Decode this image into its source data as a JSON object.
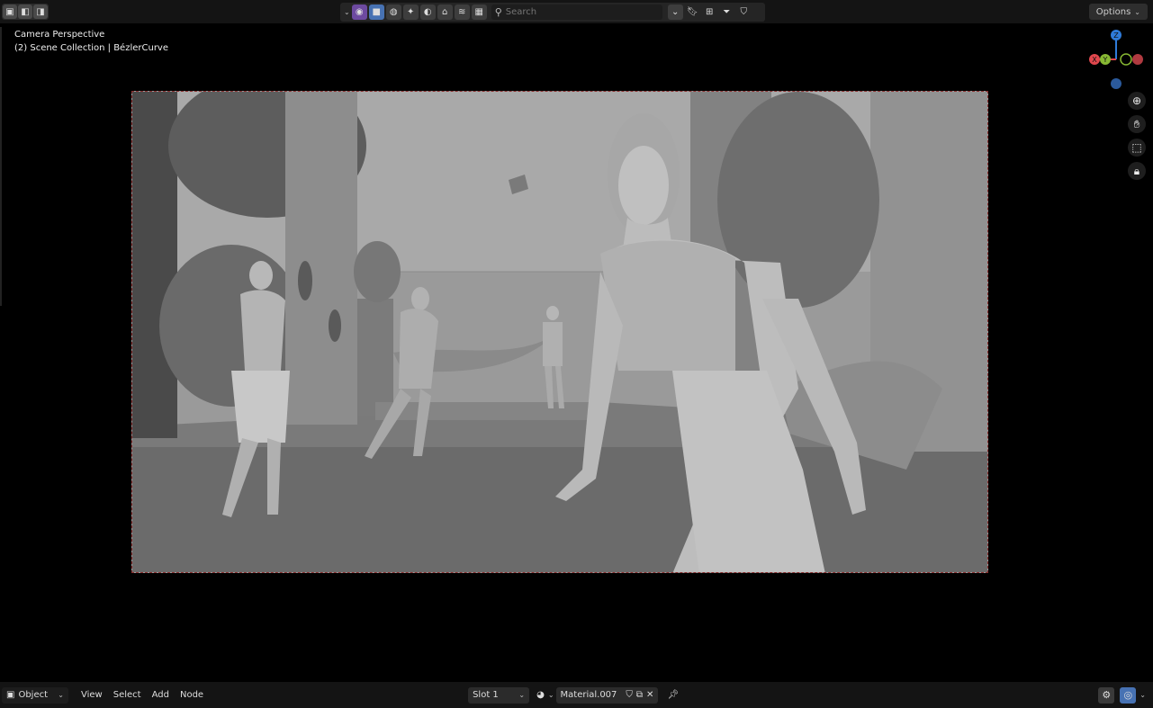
{
  "header": {
    "search_placeholder": "Search",
    "options_label": "Options"
  },
  "viewport": {
    "line1": "Camera Perspective",
    "line2": "(2) Scene Collection | BézlerCurve"
  },
  "gizmo": {
    "z": "Z",
    "y": "Y",
    "x": "X"
  },
  "footer": {
    "mode_label": "Object",
    "menus": [
      "View",
      "Select",
      "Add",
      "Node"
    ],
    "slot_label": "Slot 1",
    "material_name": "Material.007"
  },
  "colors": {
    "accent": "#4772b3",
    "axis_x": "#e0474d",
    "axis_y": "#87b833",
    "axis_z": "#2f7bd9"
  }
}
